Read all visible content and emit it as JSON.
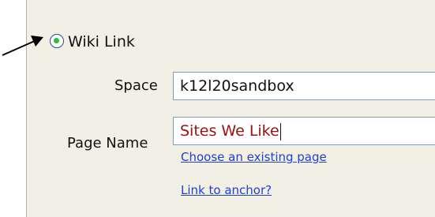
{
  "link_type": {
    "option_label": "Wiki Link",
    "selected": true
  },
  "space": {
    "label": "Space",
    "value": "k12l20sandbox"
  },
  "page": {
    "label": "Page Name",
    "value": "Sites We Like"
  },
  "links": {
    "choose_existing": "Choose an existing page",
    "link_to_anchor": "Link to anchor?"
  },
  "colors": {
    "panel_bg": "#f2efe4",
    "radio_selected": "#2dbb41",
    "link": "#1f3fd6",
    "page_value": "#9a1111"
  },
  "icons": {
    "pointer": "arrow-pointer-icon"
  }
}
